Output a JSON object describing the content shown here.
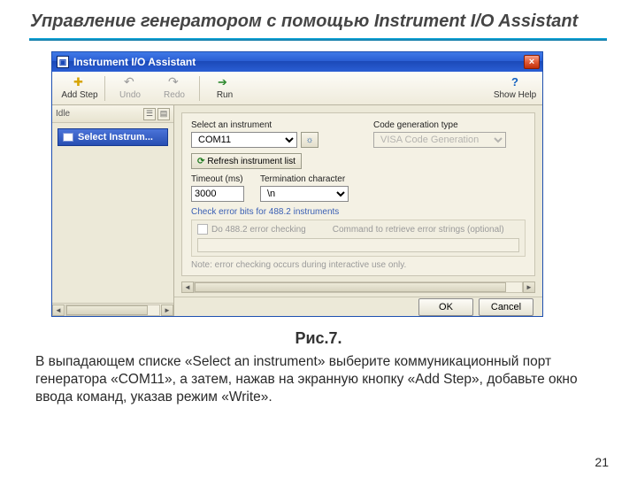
{
  "slide": {
    "title": "Управление генератором с помощью Instrument I/O Assistant",
    "caption": "Рис.7.",
    "body_text": "В выпадающем списке «Select an instrument» выберите коммуникационный порт генератора «COM11», а затем, нажав на экранную кнопку «Add Step», добавьте окно ввода команд, указав режим «Write».",
    "page_number": "21"
  },
  "dialog": {
    "title": "Instrument I/O Assistant",
    "close_glyph": "×",
    "toolbar": {
      "add_step": "Add Step",
      "undo": "Undo",
      "redo": "Redo",
      "run": "Run",
      "show_help": "Show Help"
    },
    "left": {
      "status": "Idle",
      "step1": "Select Instrum..."
    },
    "panel": {
      "select_instrument_label": "Select an instrument",
      "select_instrument_value": "COM11",
      "refresh_label": "Refresh instrument list",
      "timeout_label": "Timeout (ms)",
      "timeout_value": "3000",
      "termchar_label": "Termination character",
      "termchar_value": "\\n",
      "codegen_label": "Code generation type",
      "codegen_value": "VISA Code Generation",
      "section_title": "Check error bits for 488.2 instruments",
      "do_check_label": "Do 488.2 error checking",
      "command_placeholder": "Command to retrieve error strings (optional)",
      "note": "Note: error checking occurs during interactive use only."
    },
    "footer": {
      "ok": "OK",
      "cancel": "Cancel"
    }
  }
}
